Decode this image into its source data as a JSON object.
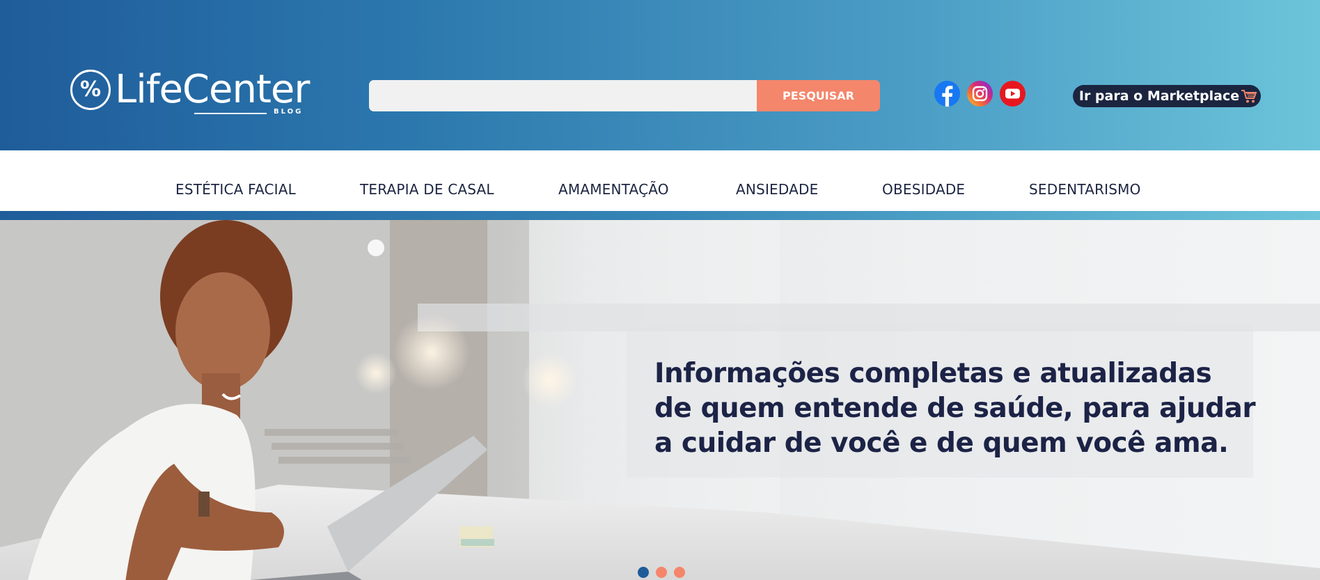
{
  "header": {
    "logo": {
      "name": "LifeCenter",
      "sub": "BLOG",
      "symbol": "%"
    },
    "search": {
      "value": "",
      "placeholder": "",
      "button_label": "PESQUISAR"
    },
    "social": [
      {
        "name": "facebook-icon",
        "color": "#1877f2"
      },
      {
        "name": "instagram-icon",
        "color": "#d62976"
      },
      {
        "name": "youtube-icon",
        "color": "#e8171f"
      }
    ],
    "marketplace_label": "Ir para o Marketplace"
  },
  "nav": {
    "items": [
      {
        "label": "ESTÉTICA FACIAL"
      },
      {
        "label": "TERAPIA DE CASAL"
      },
      {
        "label": "AMAMENTAÇÃO"
      },
      {
        "label": "ANSIEDADE"
      },
      {
        "label": "OBESIDADE"
      },
      {
        "label": "SEDENTARISMO"
      }
    ]
  },
  "hero": {
    "lines": [
      "Informações completas e atualizadas",
      "de quem entende de saúde,  para ajudar",
      "a cuidar de você e de quem você ama."
    ],
    "slides": {
      "count": 3,
      "active": 1
    }
  },
  "colors": {
    "header_start": "#1f5c9a",
    "header_end": "#6cc4da",
    "accent": "#f4866b",
    "navy": "#1c2541"
  }
}
